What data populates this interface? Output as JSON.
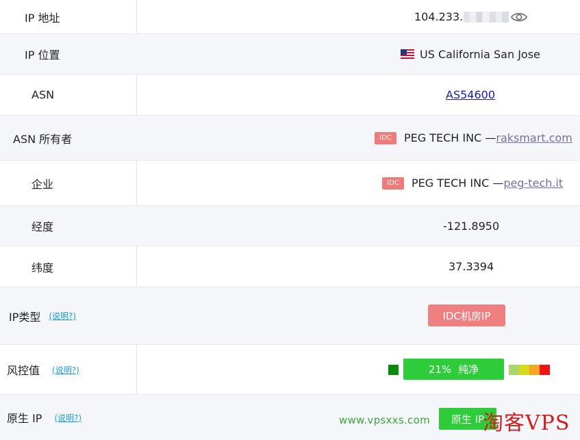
{
  "rows": {
    "ip_address": {
      "label": "IP 地址",
      "value_prefix": "104.233."
    },
    "ip_location": {
      "label": "IP 位置",
      "flag": "us-flag-icon",
      "value": "US California San Jose"
    },
    "asn": {
      "label": "ASN",
      "value": "AS54600"
    },
    "asn_owner": {
      "label": "ASN 所有者",
      "badge": "IDC",
      "name": "PEG TECH INC —",
      "link": "raksmart.com"
    },
    "enterprise": {
      "label": "企业",
      "badge": "IDC",
      "name": "PEG TECH INC —",
      "link": "peg-tech.it"
    },
    "longitude": {
      "label": "经度",
      "value": "-121.8950"
    },
    "latitude": {
      "label": "纬度",
      "value": "37.3394"
    },
    "ip_type": {
      "label": "IP类型",
      "help": "(说明?)",
      "value": "IDC机房IP"
    },
    "risk": {
      "label": "风控值",
      "help": "(说明?)",
      "percent": "21%",
      "status": "纯净",
      "level": 0.21
    },
    "native_ip": {
      "label": "原生 IP",
      "help": "(说明?)",
      "value": "原生 IP"
    }
  },
  "risk_scale_colors": [
    "#a6d86e",
    "#d9d81a",
    "#f5a623",
    "#f01414"
  ],
  "colors": {
    "accent_green": "#2ecc3a",
    "idc_red": "#f08080",
    "link": "#1a1aa6"
  },
  "watermark": {
    "url": "www.vpsxxs.com",
    "brand": "淘客VPS"
  }
}
